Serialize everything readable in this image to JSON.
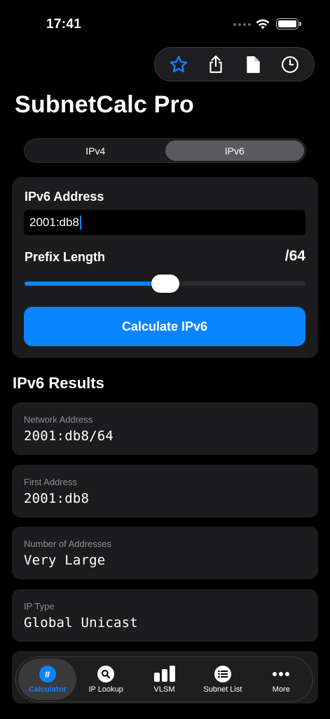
{
  "status_bar": {
    "time": "17:41"
  },
  "title": "SubnetCalc Pro",
  "segments": [
    {
      "label": "IPv4",
      "active": false
    },
    {
      "label": "IPv6",
      "active": true
    }
  ],
  "input": {
    "address_label": "IPv6 Address",
    "address_value": "2001:db8",
    "prefix_label": "Prefix Length",
    "prefix_display": "/64",
    "prefix_fraction": 0.5,
    "calculate_label": "Calculate IPv6"
  },
  "results": {
    "title": "IPv6 Results",
    "items": [
      {
        "label": "Network Address",
        "value": "2001:db8/64"
      },
      {
        "label": "First Address",
        "value": "2001:db8"
      },
      {
        "label": "Number of Addresses",
        "value": "Very Large"
      },
      {
        "label": "IP Type",
        "value": "Global Unicast"
      }
    ]
  },
  "tabs": [
    {
      "label": "Calculator",
      "icon": "number-icon",
      "active": true
    },
    {
      "label": "IP Lookup",
      "icon": "magnifier-icon",
      "active": false
    },
    {
      "label": "VLSM",
      "icon": "bar-chart-icon",
      "active": false
    },
    {
      "label": "Subnet List",
      "icon": "list-icon",
      "active": false
    },
    {
      "label": "More",
      "icon": "ellipsis-icon",
      "active": false
    }
  ],
  "colors": {
    "accent": "#0a84ff",
    "background": "#000000",
    "card": "#1c1c1e",
    "muted": "#8e8e93"
  }
}
